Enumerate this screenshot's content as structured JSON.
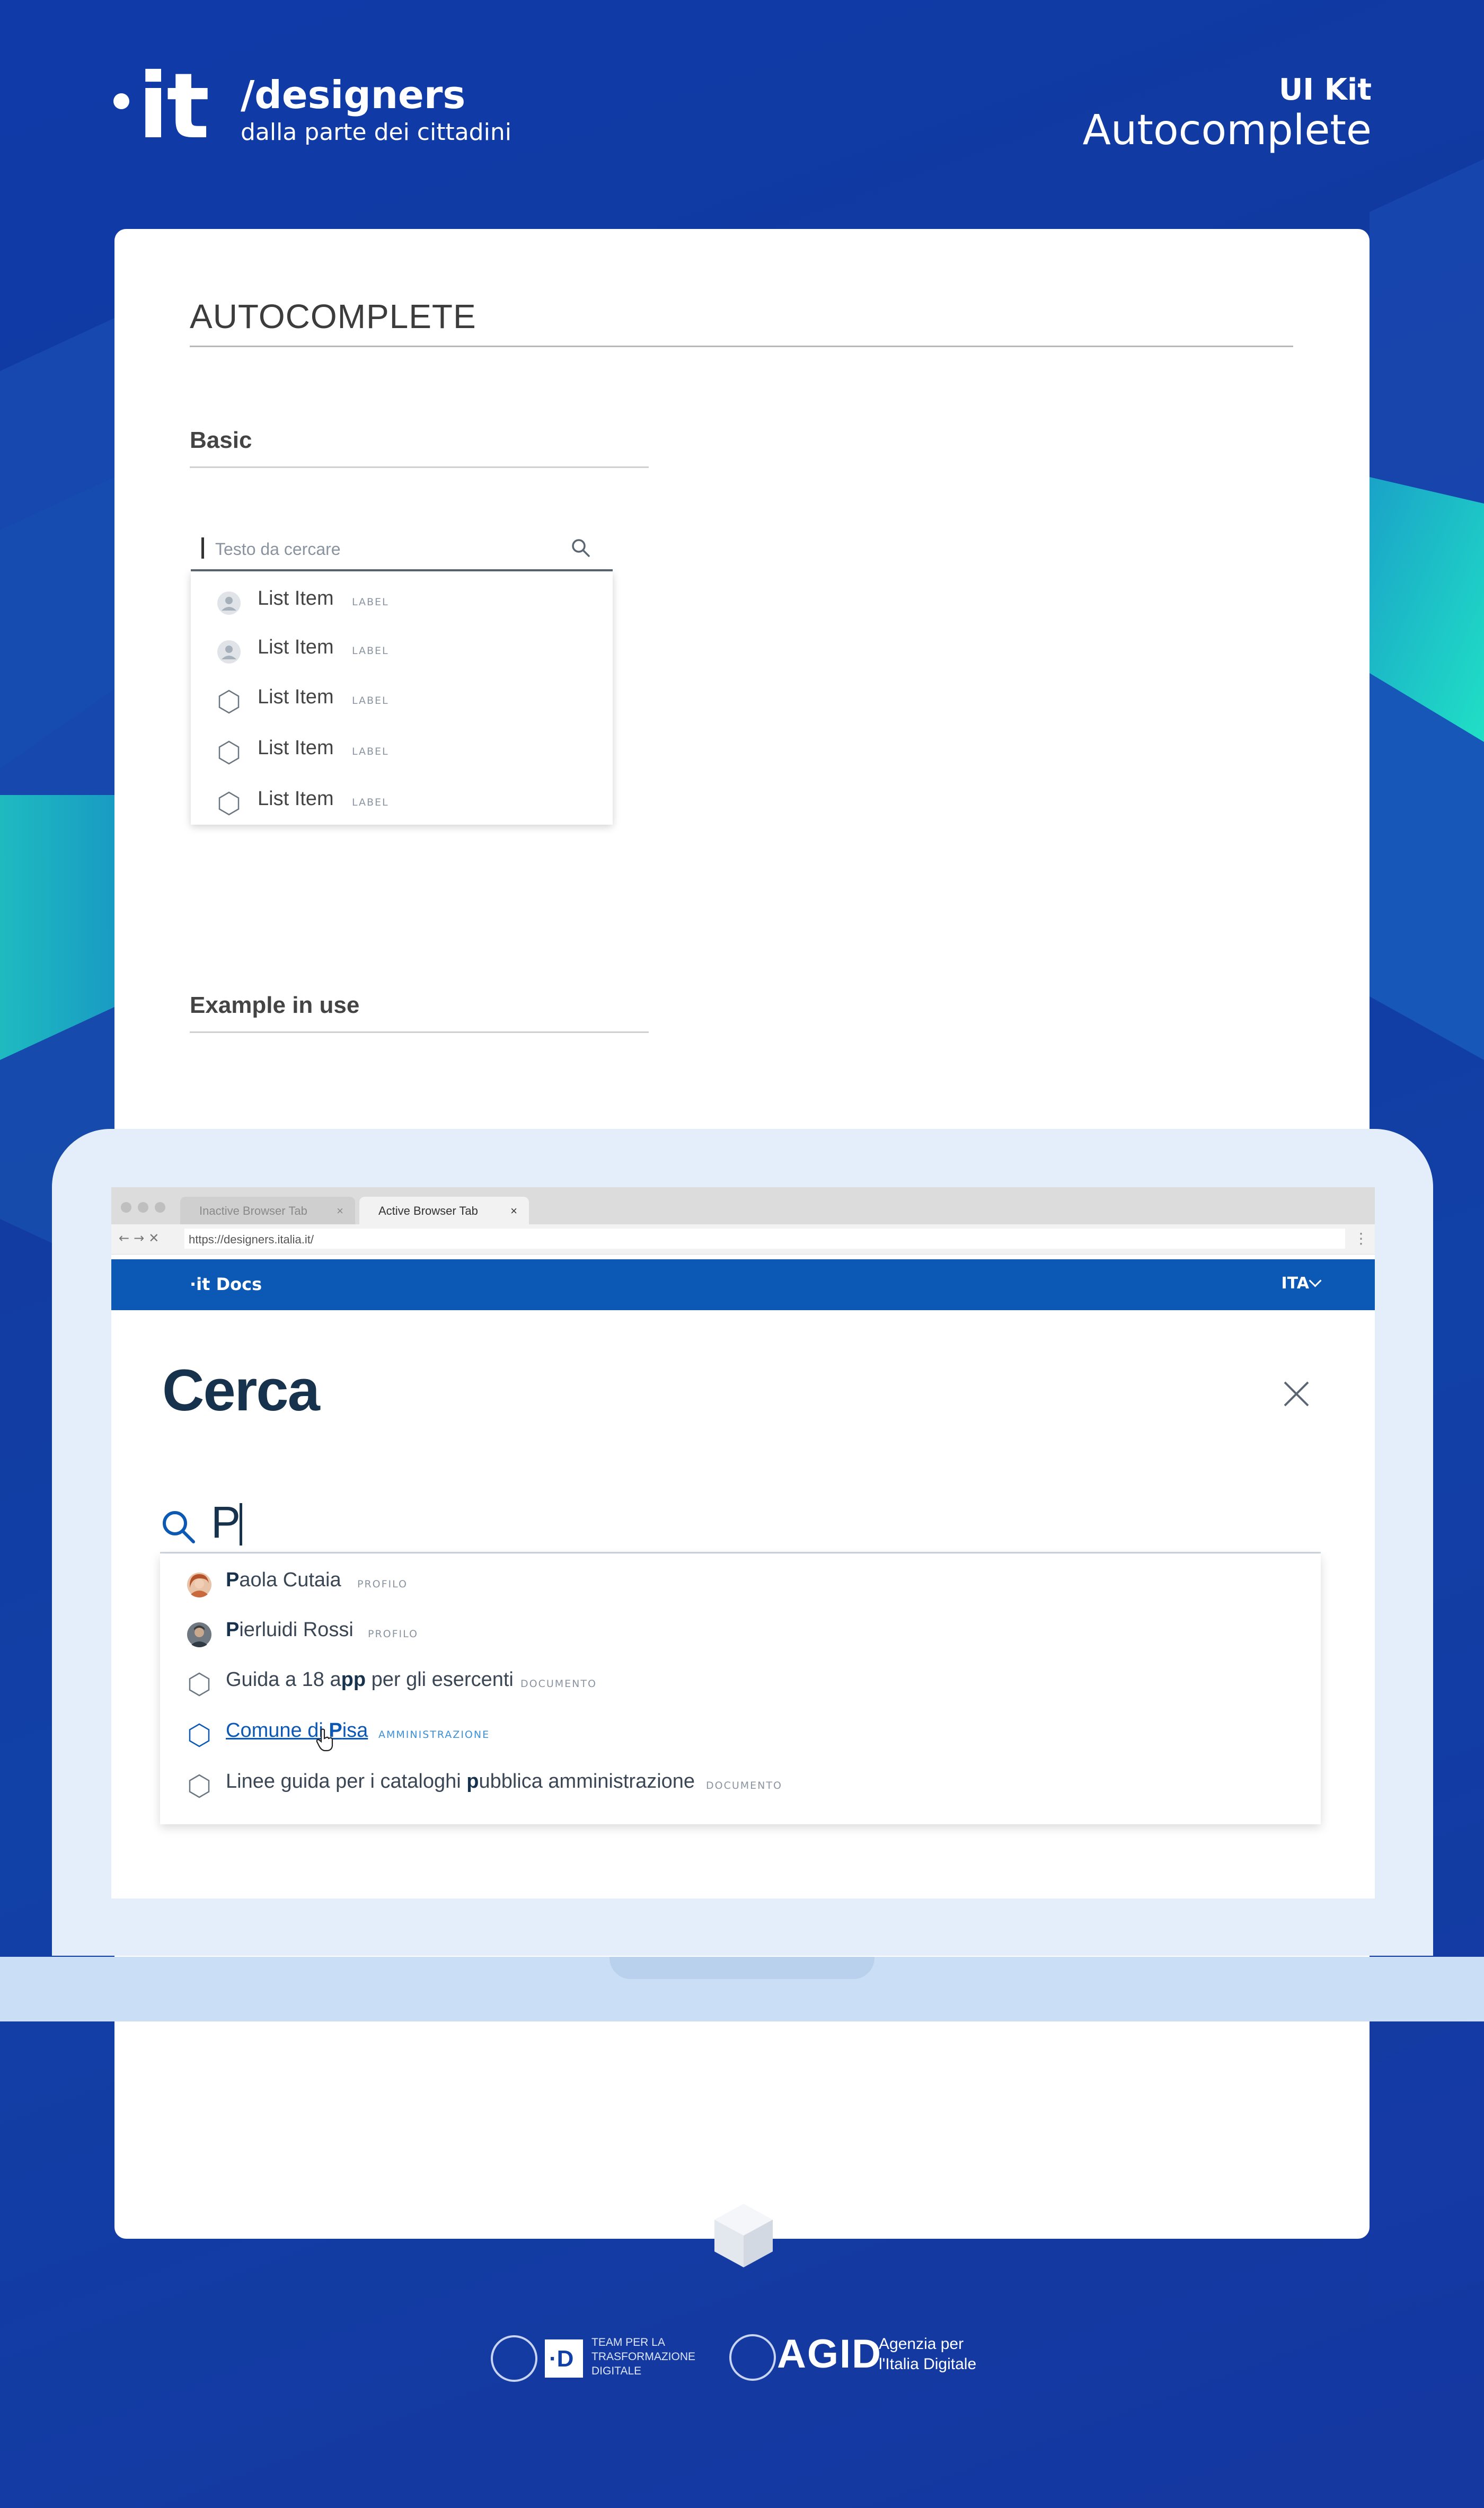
{
  "header": {
    "brand_title": "/designers",
    "brand_subtitle": "dalla parte dei cittadini",
    "logo_text": "it",
    "kit_label": "UI Kit",
    "kit_title": "Autocomplete"
  },
  "card": {
    "section_title": "AUTOCOMPLETE",
    "basic_title": "Basic",
    "example_title": "Example in use",
    "basic_input": {
      "placeholder": "Testo da cercare",
      "icon": "search-icon"
    },
    "basic_items": [
      {
        "icon": "avatar-placeholder-icon",
        "label": "List Item",
        "tag": "LABEL"
      },
      {
        "icon": "avatar-placeholder-icon",
        "label": "List Item",
        "tag": "LABEL"
      },
      {
        "icon": "hexagon-icon",
        "label": "List Item",
        "tag": "LABEL"
      },
      {
        "icon": "hexagon-icon",
        "label": "List Item",
        "tag": "LABEL"
      },
      {
        "icon": "hexagon-icon",
        "label": "List Item",
        "tag": "LABEL"
      }
    ]
  },
  "browser": {
    "tab_inactive": "Inactive Browser Tab",
    "tab_active": "Active Browser Tab",
    "tab_close": "×",
    "url": "https://designers.italia.it/",
    "site_logo": "·it Docs",
    "language": "ITA",
    "page_title": "Cerca",
    "query": "P",
    "results": [
      {
        "icon": "avatar-photo",
        "bold": "P",
        "rest": "aola Cutaia",
        "tag": "PROFILO"
      },
      {
        "icon": "avatar-photo",
        "bold": "P",
        "rest": "ierluidi Rossi",
        "tag": "PROFILO"
      },
      {
        "icon": "hexagon-icon",
        "pre": "Guida a 18 a",
        "bold": "pp",
        "rest": " per gli esercenti",
        "tag": "DOCUMENTO"
      },
      {
        "icon": "hexagon-icon",
        "pre": "Comune di ",
        "bold": "P",
        "rest": "isa",
        "tag": "AMMINISTRAZIONE",
        "highlighted": true
      },
      {
        "icon": "hexagon-icon",
        "pre": "Linee guida per i cataloghi ",
        "bold": "p",
        "rest": "ubblica amministrazione",
        "tag": "DOCUMENTO"
      }
    ]
  },
  "footer": {
    "team_text": "TEAM PER LA TRASFORMAZIONE DIGITALE",
    "d_letter": "·D",
    "agid": "AGID",
    "agid_sub_1": "Agenzia per",
    "agid_sub_2": "l'Italia Digitale"
  },
  "colors": {
    "primary": "#0b59b5",
    "background": "#1140a6",
    "teal": "#1fd4c0",
    "text_dark": "#17324d"
  }
}
